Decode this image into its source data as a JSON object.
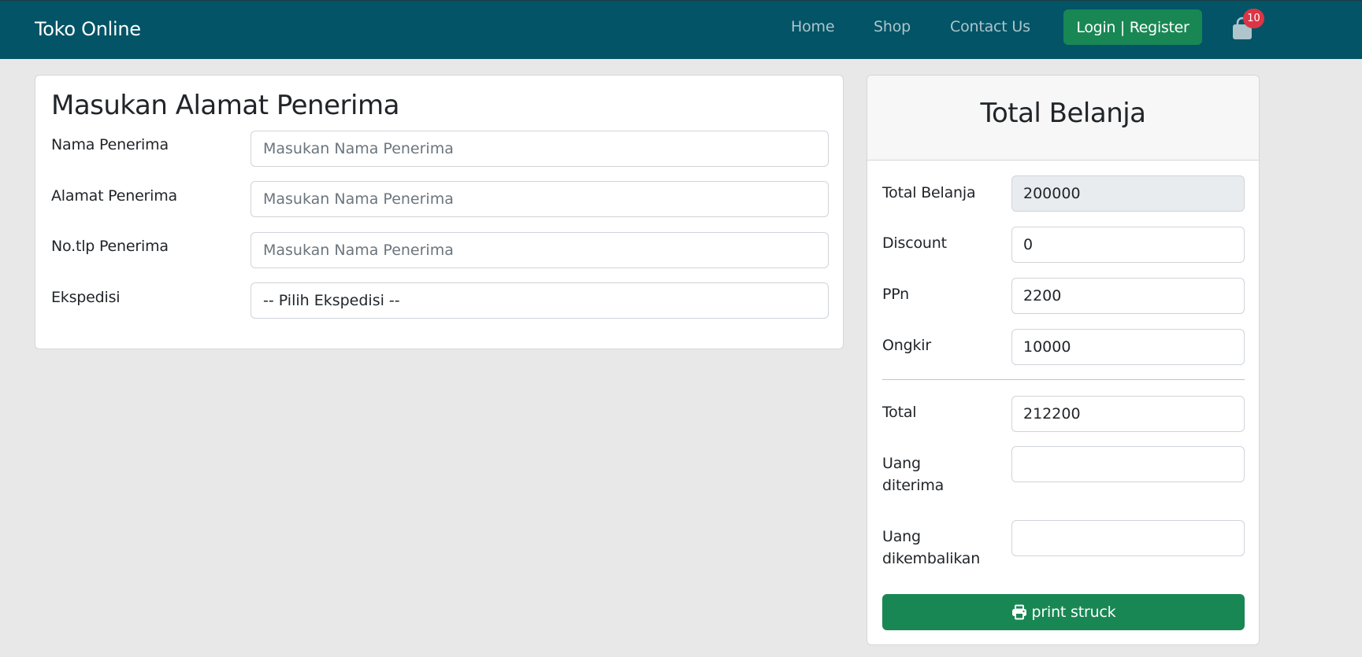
{
  "navbar": {
    "brand": "Toko Online",
    "links": [
      "Home",
      "Shop",
      "Contact Us"
    ],
    "login_label": "Login | Register",
    "cart_count": "10"
  },
  "address_form": {
    "title": "Masukan Alamat Penerima",
    "fields": [
      {
        "label": "Nama Penerima",
        "placeholder": "Masukan Nama Penerima",
        "value": ""
      },
      {
        "label": "Alamat Penerima",
        "placeholder": "Masukan Nama Penerima",
        "value": ""
      },
      {
        "label": "No.tlp Penerima",
        "placeholder": "Masukan Nama Penerima",
        "value": ""
      }
    ],
    "expedition_label": "Ekspedisi",
    "expedition_selected": "-- Pilih Ekspedisi --"
  },
  "summary": {
    "title": "Total Belanja",
    "total_belanja_label": "Total Belanja",
    "total_belanja_value": "200000",
    "discount_label": "Discount",
    "discount_value": "0",
    "ppn_label": "PPn",
    "ppn_value": "2200",
    "ongkir_label": "Ongkir",
    "ongkir_value": "10000",
    "total_label": "Total",
    "total_value": "212200",
    "uang_diterima_label_1": "Uang",
    "uang_diterima_label_2": "diterima",
    "uang_diterima_value": "",
    "uang_dikembalikan_label_1": "Uang",
    "uang_dikembalikan_label_2": "dikembalikan",
    "uang_dikembalikan_value": "",
    "print_label": "print struck"
  },
  "colors": {
    "navbar": "#025466",
    "button_green": "#198754",
    "badge_red": "#dc3545",
    "page_bg": "#e9e8e9"
  },
  "icons": {
    "cart": "shopping-bag-icon",
    "print": "printer-icon"
  }
}
